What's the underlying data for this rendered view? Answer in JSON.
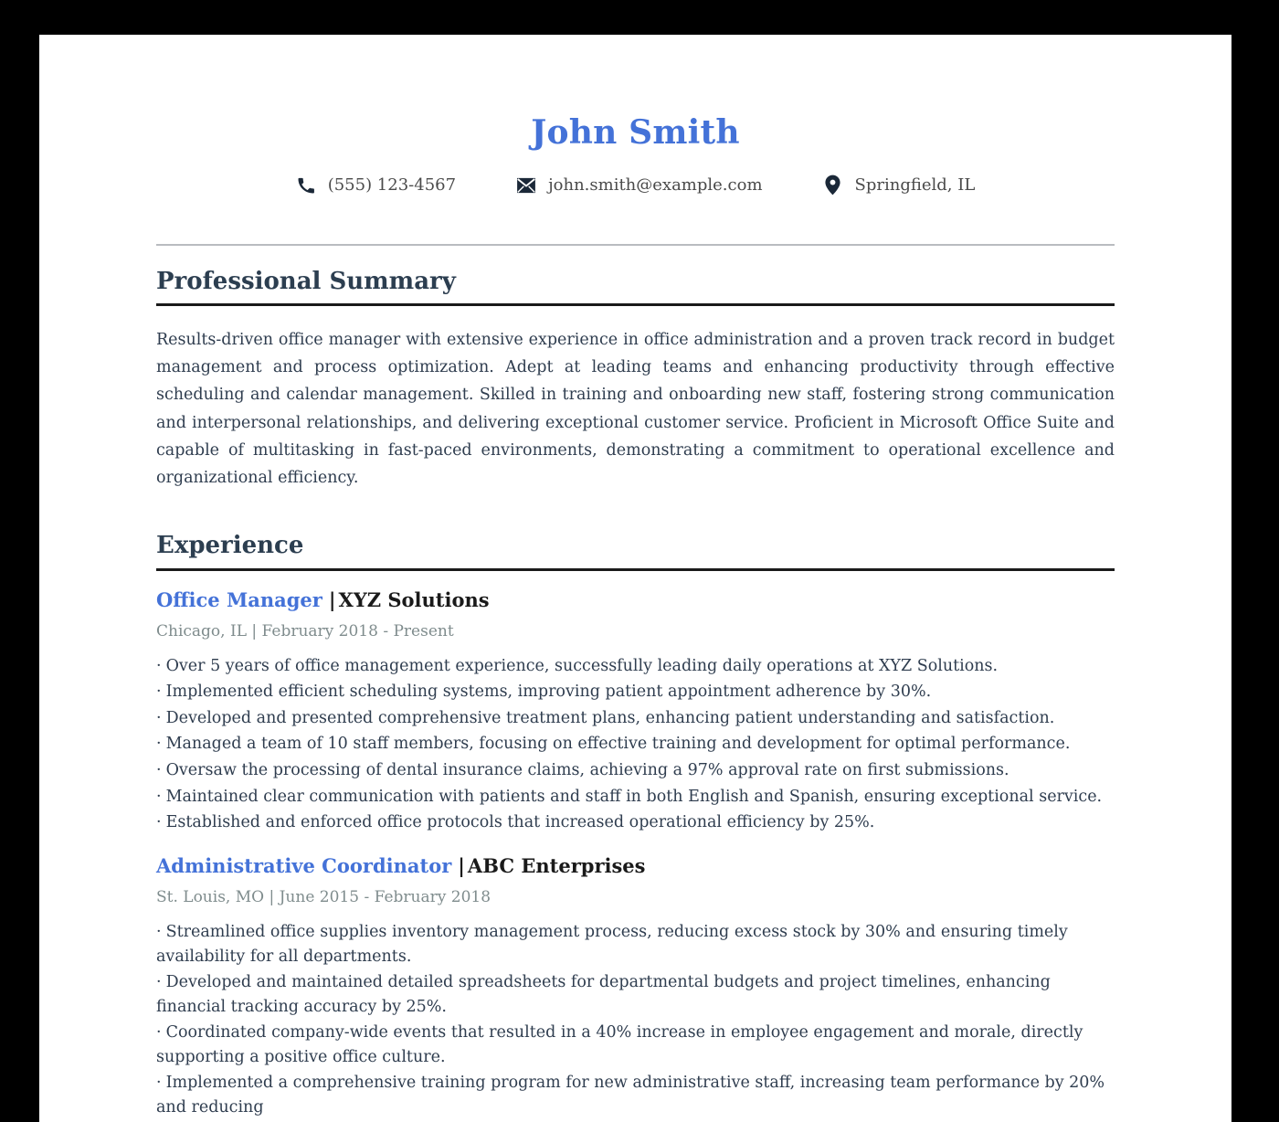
{
  "document": {
    "type": "resume",
    "page_background": "#ffffff",
    "canvas_background": "#000000",
    "accent_color": "#4472d8",
    "heading_color": "#2c3e50",
    "body_color": "#2f3d4f",
    "meta_color": "#7f8c8d"
  },
  "header": {
    "name": "John Smith",
    "contacts": [
      {
        "icon": "phone-icon",
        "text": "(555) 123-4567"
      },
      {
        "icon": "envelope-icon",
        "text": "john.smith@example.com"
      },
      {
        "icon": "location-pin-icon",
        "text": "Springfield, IL"
      }
    ]
  },
  "summary": {
    "title": "Professional Summary",
    "text": "Results-driven office manager with extensive experience in office administration and a proven track record in budget management and process optimization. Adept at leading teams and enhancing productivity through effective scheduling and calendar management. Skilled in training and onboarding new staff, fostering strong communication and interpersonal relationships, and delivering exceptional customer service. Proficient in Microsoft Office Suite and capable of multitasking in fast-paced environments, demonstrating a commitment to operational excellence and organizational efficiency."
  },
  "experience": {
    "title": "Experience",
    "separator": "|",
    "bullet_marker": "·",
    "jobs": [
      {
        "title": "Office Manager",
        "company": "XYZ Solutions",
        "meta": "Chicago, IL | February 2018 - Present",
        "bullets": [
          "Over 5 years of office management experience, successfully leading daily operations at XYZ Solutions.",
          "Implemented efficient scheduling systems, improving patient appointment adherence by 30%.",
          "Developed and presented comprehensive treatment plans, enhancing patient understanding and satisfaction.",
          "Managed a team of 10 staff members, focusing on effective training and development for optimal performance.",
          "Oversaw the processing of dental insurance claims, achieving a 97% approval rate on first submissions.",
          "Maintained clear communication with patients and staff in both English and Spanish, ensuring exceptional service.",
          "Established and enforced office protocols that increased operational efficiency by 25%."
        ]
      },
      {
        "title": "Administrative Coordinator",
        "company": "ABC Enterprises",
        "meta": "St. Louis, MO | June 2015 - February 2018",
        "bullets": [
          "Streamlined office supplies inventory management process, reducing excess stock by 30% and ensuring timely availability for all departments.",
          "Developed and maintained detailed spreadsheets for departmental budgets and project timelines, enhancing financial tracking accuracy by 25%.",
          "Coordinated company-wide events that resulted in a 40% increase in employee engagement and morale, directly supporting a positive office culture.",
          "Implemented a comprehensive training program for new administrative staff, increasing team performance by 20% and reducing"
        ]
      }
    ]
  }
}
